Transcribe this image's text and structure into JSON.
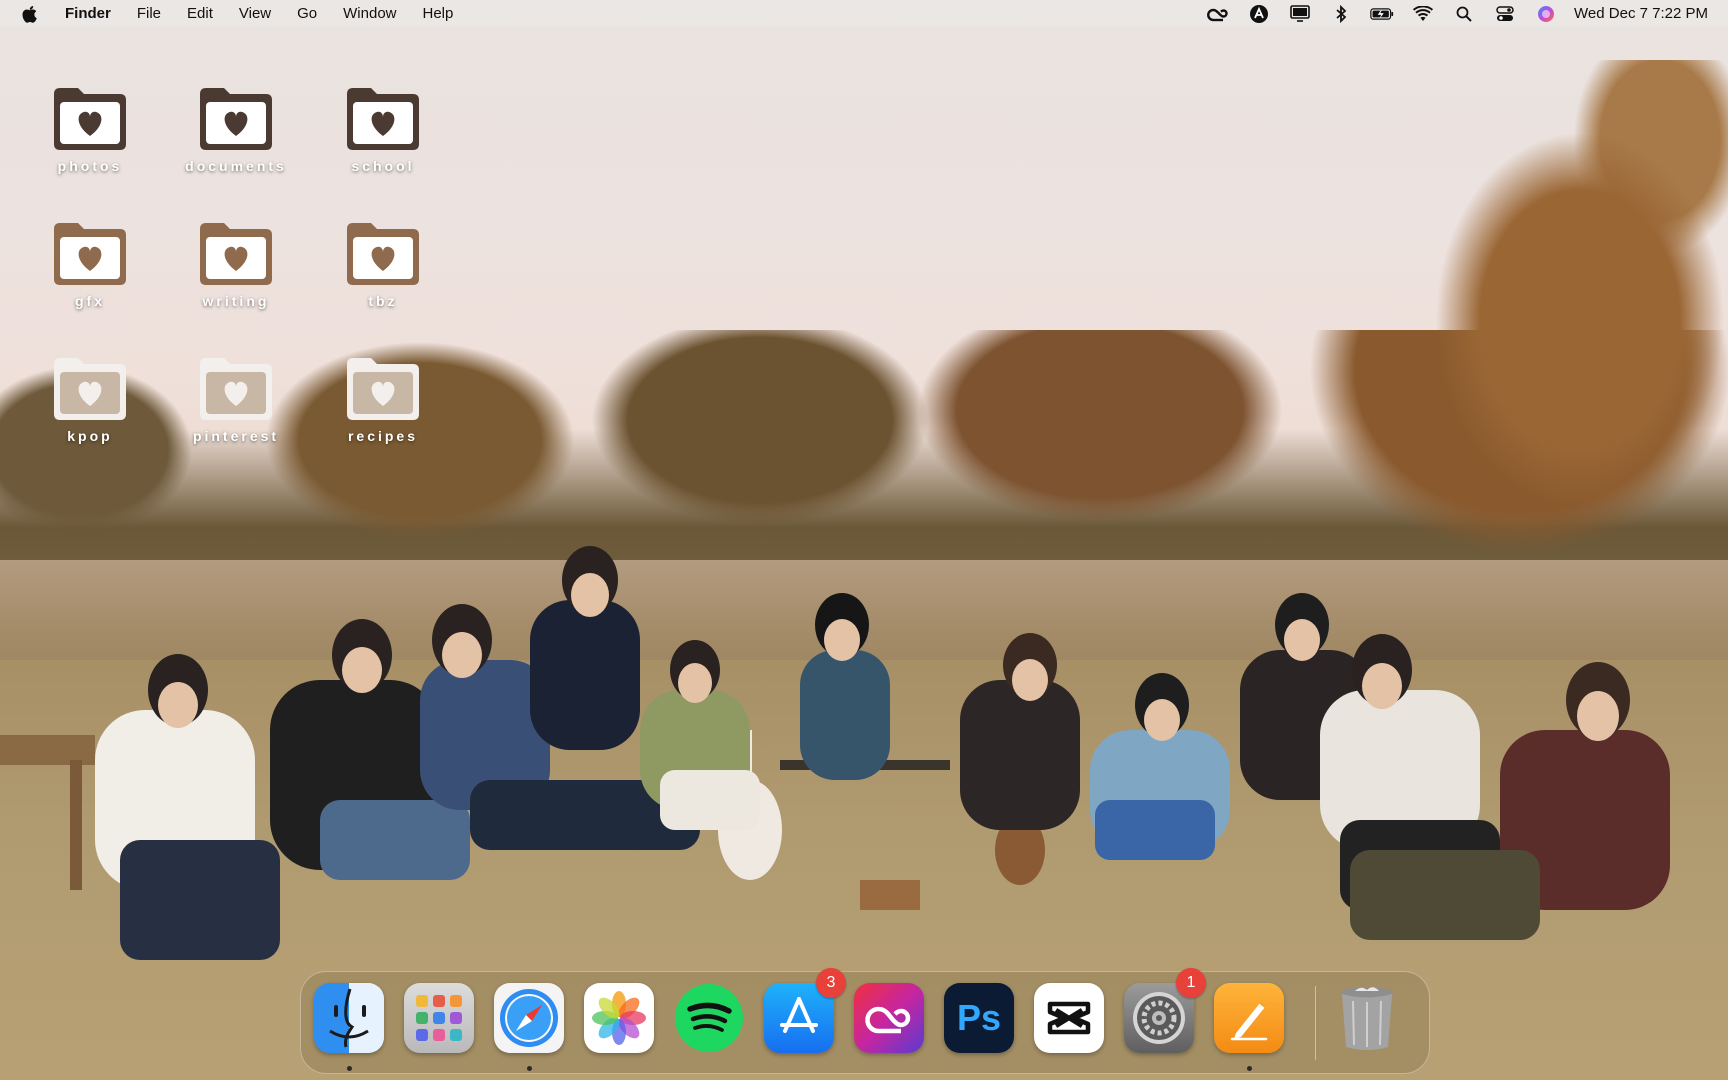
{
  "menubar": {
    "app_name": "Finder",
    "menus": [
      "File",
      "Edit",
      "View",
      "Go",
      "Window",
      "Help"
    ],
    "status_icons": [
      "creative-cloud-icon",
      "vpn-icon",
      "display-icon",
      "bluetooth-icon",
      "battery-charging-icon",
      "wifi-icon",
      "spotlight-search-icon",
      "control-center-icon",
      "siri-icon"
    ],
    "clock": "Wed Dec 7  7:22 PM"
  },
  "desktop": {
    "folders": [
      {
        "label": "photos",
        "color": "#4b3a32"
      },
      {
        "label": "documents",
        "color": "#4b3a32"
      },
      {
        "label": "school",
        "color": "#4b3a32"
      },
      {
        "label": "gfx",
        "color": "#8f6a4c"
      },
      {
        "label": "writing",
        "color": "#8f6a4c"
      },
      {
        "label": "tbz",
        "color": "#8f6a4c"
      },
      {
        "label": "kpop",
        "color": "#f3efec"
      },
      {
        "label": "pinterest",
        "color": "#f3efec"
      },
      {
        "label": "recipes",
        "color": "#f3efec"
      }
    ]
  },
  "dock": {
    "apps": [
      {
        "name": "Finder",
        "running": true
      },
      {
        "name": "Launchpad"
      },
      {
        "name": "Safari",
        "running": true
      },
      {
        "name": "Photos"
      },
      {
        "name": "Spotify"
      },
      {
        "name": "App Store",
        "badge": "3"
      },
      {
        "name": "Creative Cloud"
      },
      {
        "name": "Photoshop",
        "label": "Ps"
      },
      {
        "name": "CapCut"
      },
      {
        "name": "System Preferences",
        "badge": "1"
      },
      {
        "name": "Pages",
        "running": true
      }
    ],
    "trash": {
      "name": "Trash"
    }
  }
}
